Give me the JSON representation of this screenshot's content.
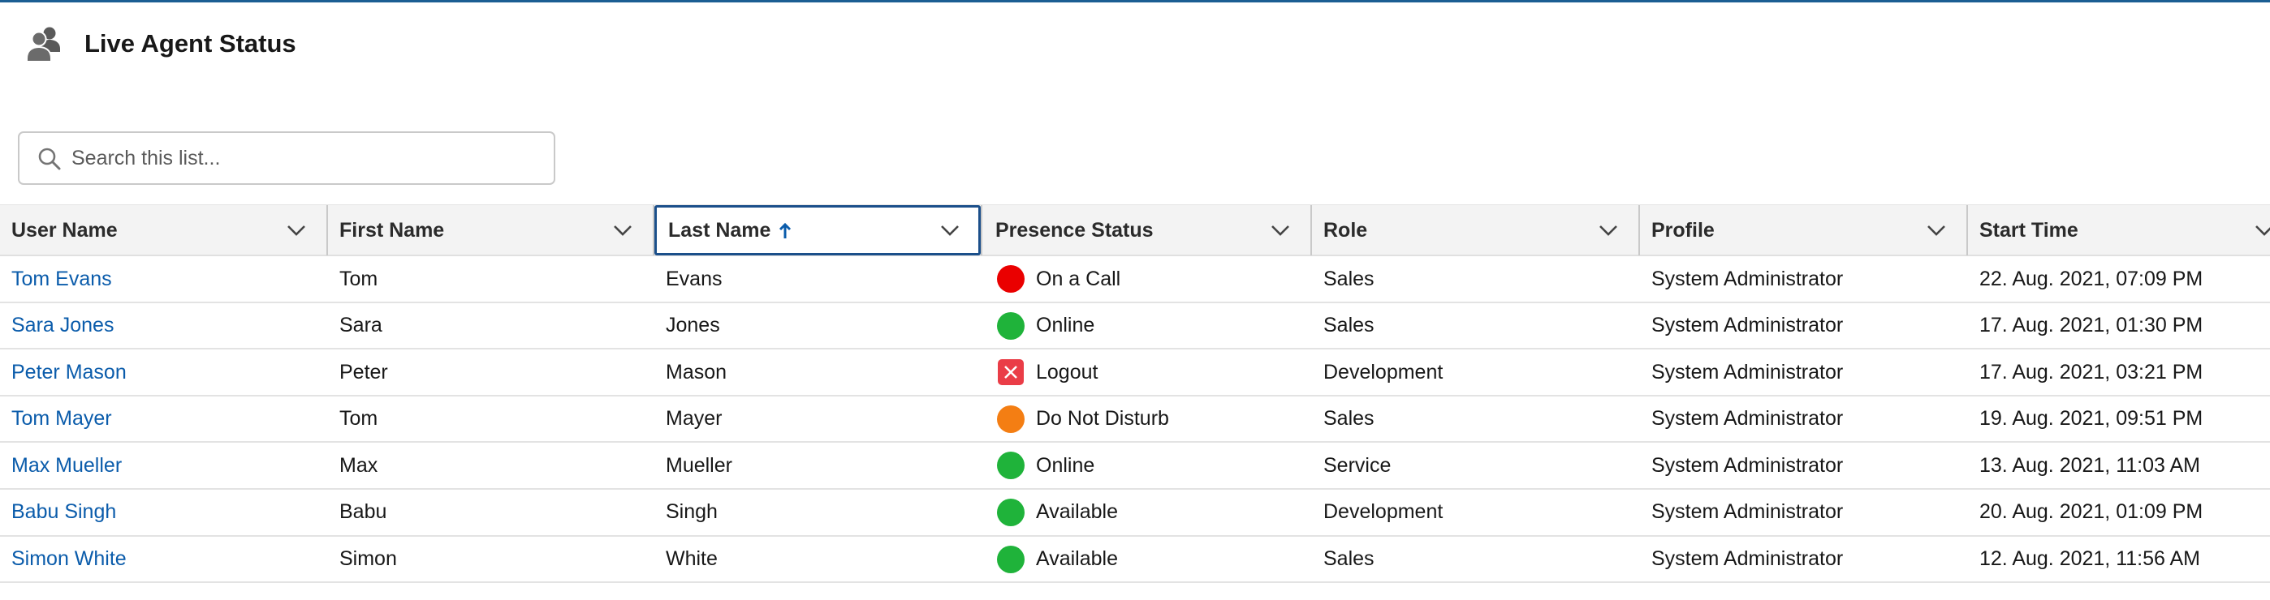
{
  "header": {
    "title": "Live Agent Status",
    "icon": "users-icon"
  },
  "search": {
    "placeholder": "Search this list...",
    "value": ""
  },
  "columns": [
    {
      "label": "User Name"
    },
    {
      "label": "First Name"
    },
    {
      "label": "Last Name",
      "sorted": "ascending"
    },
    {
      "label": "Presence Status"
    },
    {
      "label": "Role"
    },
    {
      "label": "Profile"
    },
    {
      "label": "Start Time"
    }
  ],
  "status_colors": {
    "on_call": "#ea0000",
    "online": "#1fb33a",
    "logout": "#ea3d47",
    "dnd": "#f47e13",
    "link": "#0b5cab"
  },
  "rows": [
    {
      "user_name": "Tom Evans",
      "first_name": "Tom",
      "last_name": "Evans",
      "status": "On a Call",
      "status_icon": "red-dot-icon",
      "role": "Sales",
      "profile": "System Administrator",
      "start_time": "22. Aug. 2021, 07:09 PM"
    },
    {
      "user_name": "Sara Jones",
      "first_name": "Sara",
      "last_name": "Jones",
      "status": "Online",
      "status_icon": "green-dot-icon",
      "role": "Sales",
      "profile": "System Administrator",
      "start_time": "17. Aug. 2021, 01:30 PM"
    },
    {
      "user_name": "Peter Mason",
      "first_name": "Peter",
      "last_name": "Mason",
      "status": "Logout",
      "status_icon": "logout-x-icon",
      "role": "Development",
      "profile": "System Administrator",
      "start_time": "17. Aug. 2021, 03:21 PM"
    },
    {
      "user_name": "Tom Mayer",
      "first_name": "Tom",
      "last_name": "Mayer",
      "status": "Do Not Disturb",
      "status_icon": "orange-dot-icon",
      "role": "Sales",
      "profile": "System Administrator",
      "start_time": "19. Aug. 2021, 09:51 PM"
    },
    {
      "user_name": "Max Mueller",
      "first_name": "Max",
      "last_name": "Mueller",
      "status": "Online",
      "status_icon": "green-dot-icon",
      "role": "Service",
      "profile": "System Administrator",
      "start_time": "13. Aug. 2021, 11:03 AM"
    },
    {
      "user_name": "Babu Singh",
      "first_name": "Babu",
      "last_name": "Singh",
      "status": "Available",
      "status_icon": "green-dot-icon",
      "role": "Development",
      "profile": "System Administrator",
      "start_time": "20. Aug. 2021, 01:09 PM"
    },
    {
      "user_name": "Simon White",
      "first_name": "Simon",
      "last_name": "White",
      "status": "Available",
      "status_icon": "green-dot-icon",
      "role": "Sales",
      "profile": "System Administrator",
      "start_time": "12. Aug. 2021, 11:56 AM"
    }
  ]
}
